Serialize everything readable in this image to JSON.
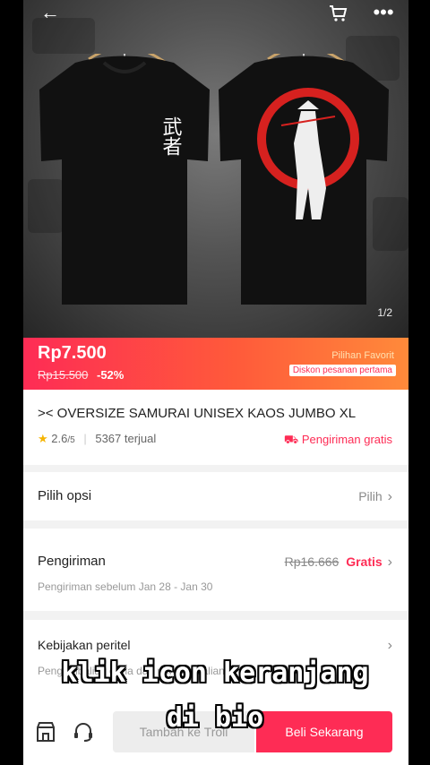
{
  "gallery": {
    "counter": "1/2",
    "shirt_kanji": "武者"
  },
  "price_banner": {
    "price": "Rp7.500",
    "old_price": "Rp15.500",
    "discount": "-52%",
    "favorite_label": "Pilihan Favorit",
    "first_order_badge": "Diskon pesanan pertama"
  },
  "product": {
    "title": ">< OVERSIZE SAMURAI UNISEX KAOS JUMBO XL",
    "rating": "2.6",
    "rating_suffix": "/5",
    "sold": "5367 terjual",
    "free_shipping": "Pengiriman gratis"
  },
  "options": {
    "label": "Pilih opsi",
    "action": "Pilih"
  },
  "shipping": {
    "label": "Pengiriman",
    "old_cost": "Rp16.666",
    "free_label": "Gratis",
    "delivery_estimate": "Pengiriman sebelum Jan 28 - Jan 30"
  },
  "policy": {
    "label": "Kebijakan peritel",
    "hint": "Pengembalian dana dan pengembalian"
  },
  "bottom_bar": {
    "add_to_cart": "Tambah ke Troli",
    "buy_now": "Beli Sekarang"
  },
  "overlay_caption": {
    "line1": "klik icon keranjang",
    "line2": "di bio"
  },
  "colors": {
    "accent": "#fe2c55",
    "banner_end": "#ff8a3a",
    "star": "#f5b400"
  }
}
